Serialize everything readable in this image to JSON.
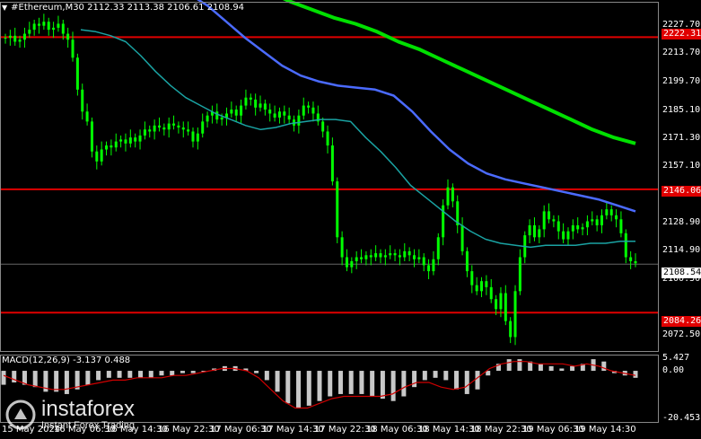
{
  "header": {
    "symbol_line": "#Ethereum,M30  2112.33 2113.38 2106.61 2108.94",
    "arrow": "▼"
  },
  "macd": {
    "title": "MACD(12,26,9) -3.137 0.488",
    "scale": [
      "5.427",
      "0.00",
      "-20.453"
    ]
  },
  "price_axis": [
    "2227.70",
    "2213.70",
    "2199.70",
    "2185.10",
    "2171.30",
    "2157.10",
    "2142.90",
    "2128.90",
    "2114.90",
    "2100.50",
    "2072.50"
  ],
  "levels": {
    "upper": "2222.31",
    "middle": "2146.06",
    "lower": "2084.26",
    "current": "2108.54"
  },
  "time_axis": [
    "15 May 2024",
    "16 May 06:30",
    "16 May 14:30",
    "16 May 22:30",
    "17 May 06:30",
    "17 May 14:30",
    "17 May 22:30",
    "18 May 06:30",
    "18 May 14:30",
    "18 May 22:30",
    "19 May 06:30",
    "19 May 14:30"
  ],
  "watermark": {
    "brand": "instaforex",
    "sub": "Instant Forex Trading"
  },
  "colors": {
    "background": "#000000",
    "candle": "#00ff00",
    "ma_fast": "#1aa3a3",
    "ma_mid": "#4b6bff",
    "ma_slow": "#00e000",
    "level": "#e00000",
    "macd_signal": "#d00000",
    "macd_hist": "#c8c8c8"
  },
  "chart_data": {
    "type": "candlestick",
    "timeframe": "M30",
    "ylim": [
      2065,
      2240
    ],
    "horizontal_levels": [
      2222.31,
      2146.06,
      2084.26
    ],
    "close_path": [
      2222,
      2223,
      2220,
      2221,
      2224,
      2226,
      2229,
      2228,
      2230,
      2226,
      2227,
      2229,
      2224,
      2221,
      2212,
      2196,
      2185,
      2180,
      2165,
      2160,
      2166,
      2168,
      2167,
      2170,
      2171,
      2169,
      2172,
      2170,
      2173,
      2176,
      2175,
      2178,
      2177,
      2176,
      2179,
      2178,
      2177,
      2176,
      2175,
      2170,
      2174,
      2180,
      2183,
      2185,
      2181,
      2182,
      2184,
      2186,
      2183,
      2188,
      2192,
      2191,
      2187,
      2189,
      2186,
      2184,
      2182,
      2185,
      2183,
      2181,
      2178,
      2183,
      2188,
      2187,
      2184,
      2180,
      2175,
      2168,
      2150,
      2122,
      2112,
      2107,
      2110,
      2112,
      2111,
      2113,
      2112,
      2114,
      2112,
      2113,
      2114,
      2113,
      2112,
      2115,
      2113,
      2111,
      2112,
      2108,
      2105,
      2111,
      2122,
      2138,
      2147,
      2140,
      2128,
      2115,
      2105,
      2098,
      2095,
      2100,
      2097,
      2091,
      2086,
      2094,
      2080,
      2072,
      2095,
      2112,
      2123,
      2128,
      2122,
      2126,
      2135,
      2131,
      2130,
      2125,
      2121,
      2125,
      2128,
      2126,
      2127,
      2130,
      2131,
      2128,
      2133,
      2136,
      2133,
      2131,
      2124,
      2112,
      2110,
      2109
    ],
    "ma_fast": [
      2226,
      2225,
      2223,
      2220,
      2213,
      2205,
      2198,
      2192,
      2188,
      2184,
      2181,
      2178,
      2176,
      2177,
      2179,
      2180,
      2181,
      2181,
      2180,
      2172,
      2165,
      2157,
      2148,
      2142,
      2136,
      2130,
      2125,
      2121,
      2119,
      2118,
      2117,
      2118,
      2118,
      2118,
      2119,
      2119,
      2120,
      2120
    ],
    "ma_mid": [
      2248,
      2244,
      2238,
      2230,
      2222,
      2215,
      2208,
      2203,
      2200,
      2198,
      2197,
      2196,
      2193,
      2185,
      2175,
      2166,
      2159,
      2154,
      2151,
      2149,
      2147,
      2145,
      2143,
      2141,
      2138,
      2135
    ],
    "ma_slow": [
      2245,
      2240,
      2236,
      2232,
      2229,
      2225,
      2220,
      2216,
      2211,
      2206,
      2201,
      2196,
      2191,
      2186,
      2181,
      2176,
      2172,
      2169
    ],
    "macd_histogram": [
      -6,
      -5,
      -6,
      -7,
      -9,
      -9,
      -10,
      -8,
      -6,
      -4,
      -3,
      -3,
      -3,
      -3,
      -3,
      -2,
      -2,
      -1,
      -1,
      0,
      1,
      2,
      2,
      1,
      -1,
      -4,
      -9,
      -14,
      -16,
      -15,
      -13,
      -11,
      -10,
      -10,
      -10,
      -11,
      -12,
      -13,
      -11,
      -7,
      -4,
      -3,
      -4,
      -8,
      -10,
      -8,
      -2,
      3,
      5,
      5,
      4,
      3,
      2,
      1,
      2,
      3,
      5,
      4,
      -1,
      -2,
      -3
    ],
    "macd_signal": [
      -2,
      -4,
      -6,
      -7,
      -8,
      -8,
      -7,
      -6,
      -5,
      -4,
      -4,
      -3,
      -3,
      -3,
      -2,
      -2,
      -1,
      0,
      1,
      1,
      0,
      -3,
      -8,
      -13,
      -16,
      -16,
      -14,
      -12,
      -11,
      -11,
      -11,
      -11,
      -10,
      -7,
      -5,
      -5,
      -7,
      -8,
      -7,
      -3,
      1,
      3,
      4,
      4,
      3,
      3,
      3,
      2,
      3,
      2,
      0,
      -1,
      -2
    ],
    "macd_range": [
      -20.453,
      5.427
    ]
  }
}
